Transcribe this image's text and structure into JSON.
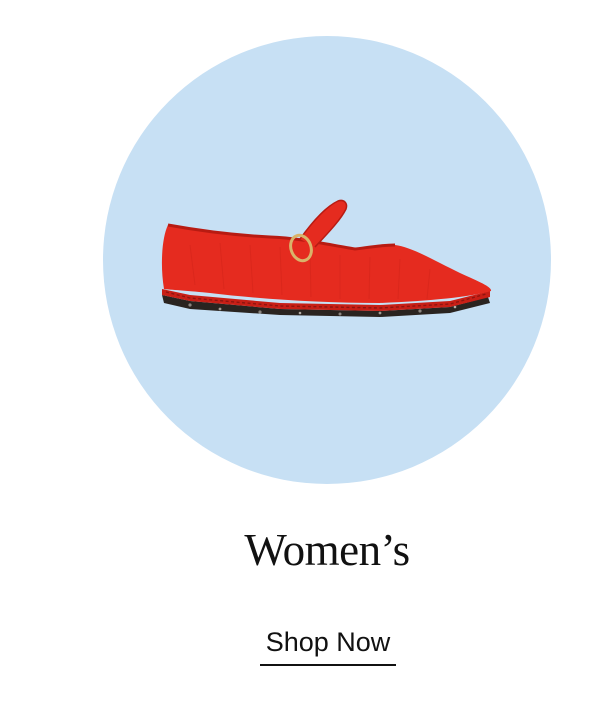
{
  "category": {
    "title": "Women’s",
    "cta_label": "Shop Now",
    "image_icon": "red-mary-jane-shoe-icon"
  },
  "colors": {
    "background": "#ffffff",
    "circle": "#c7e0f4",
    "shoe": "#e52b1f",
    "sole": "#2a2420",
    "text": "#111111"
  }
}
